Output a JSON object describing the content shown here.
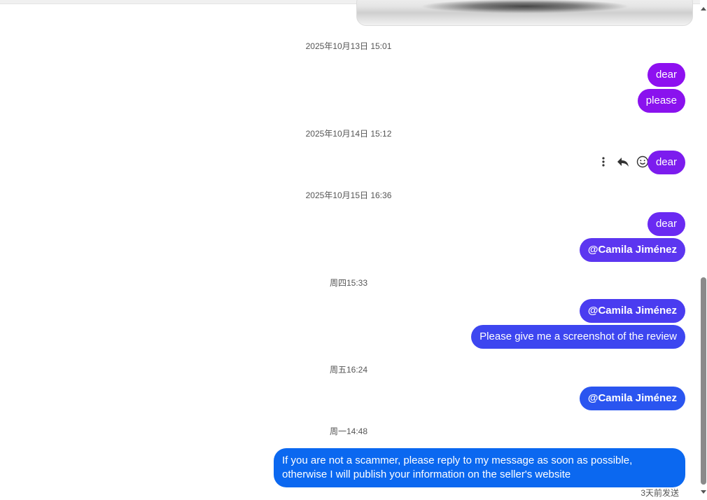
{
  "timestamps": [
    "2025年10月13日 15:01",
    "2025年10月14日 15:12",
    "2025年10月15日 16:36",
    "周四15:33",
    "周五16:24",
    "周一14:48"
  ],
  "messages": [
    {
      "text": "dear",
      "color": "#8e10f0"
    },
    {
      "text": "please",
      "color": "#8a12ee"
    },
    {
      "text": "dear",
      "color": "#7c1cee"
    },
    {
      "text": "dear",
      "color": "#6a2af2"
    },
    {
      "text": "@Camila Jiménez",
      "color": "#5c36f0"
    },
    {
      "text": "@Camila Jiménez",
      "color": "#4a3cf0"
    },
    {
      "text": "Please give me a screenshot of the review",
      "color": "#3d46f0"
    },
    {
      "text": "@Camila Jiménez",
      "color": "#2a55f0"
    },
    {
      "text": "If you are not a scammer, please reply to my message as soon as possible, otherwise I will publish your information on the seller's website",
      "color": "#0b68f0"
    }
  ],
  "message_actions": {
    "more_icon": "more-vertical-icon",
    "reply_icon": "reply-icon",
    "react_icon": "smiley-icon"
  },
  "status": {
    "sent_label": "3天前发送"
  }
}
